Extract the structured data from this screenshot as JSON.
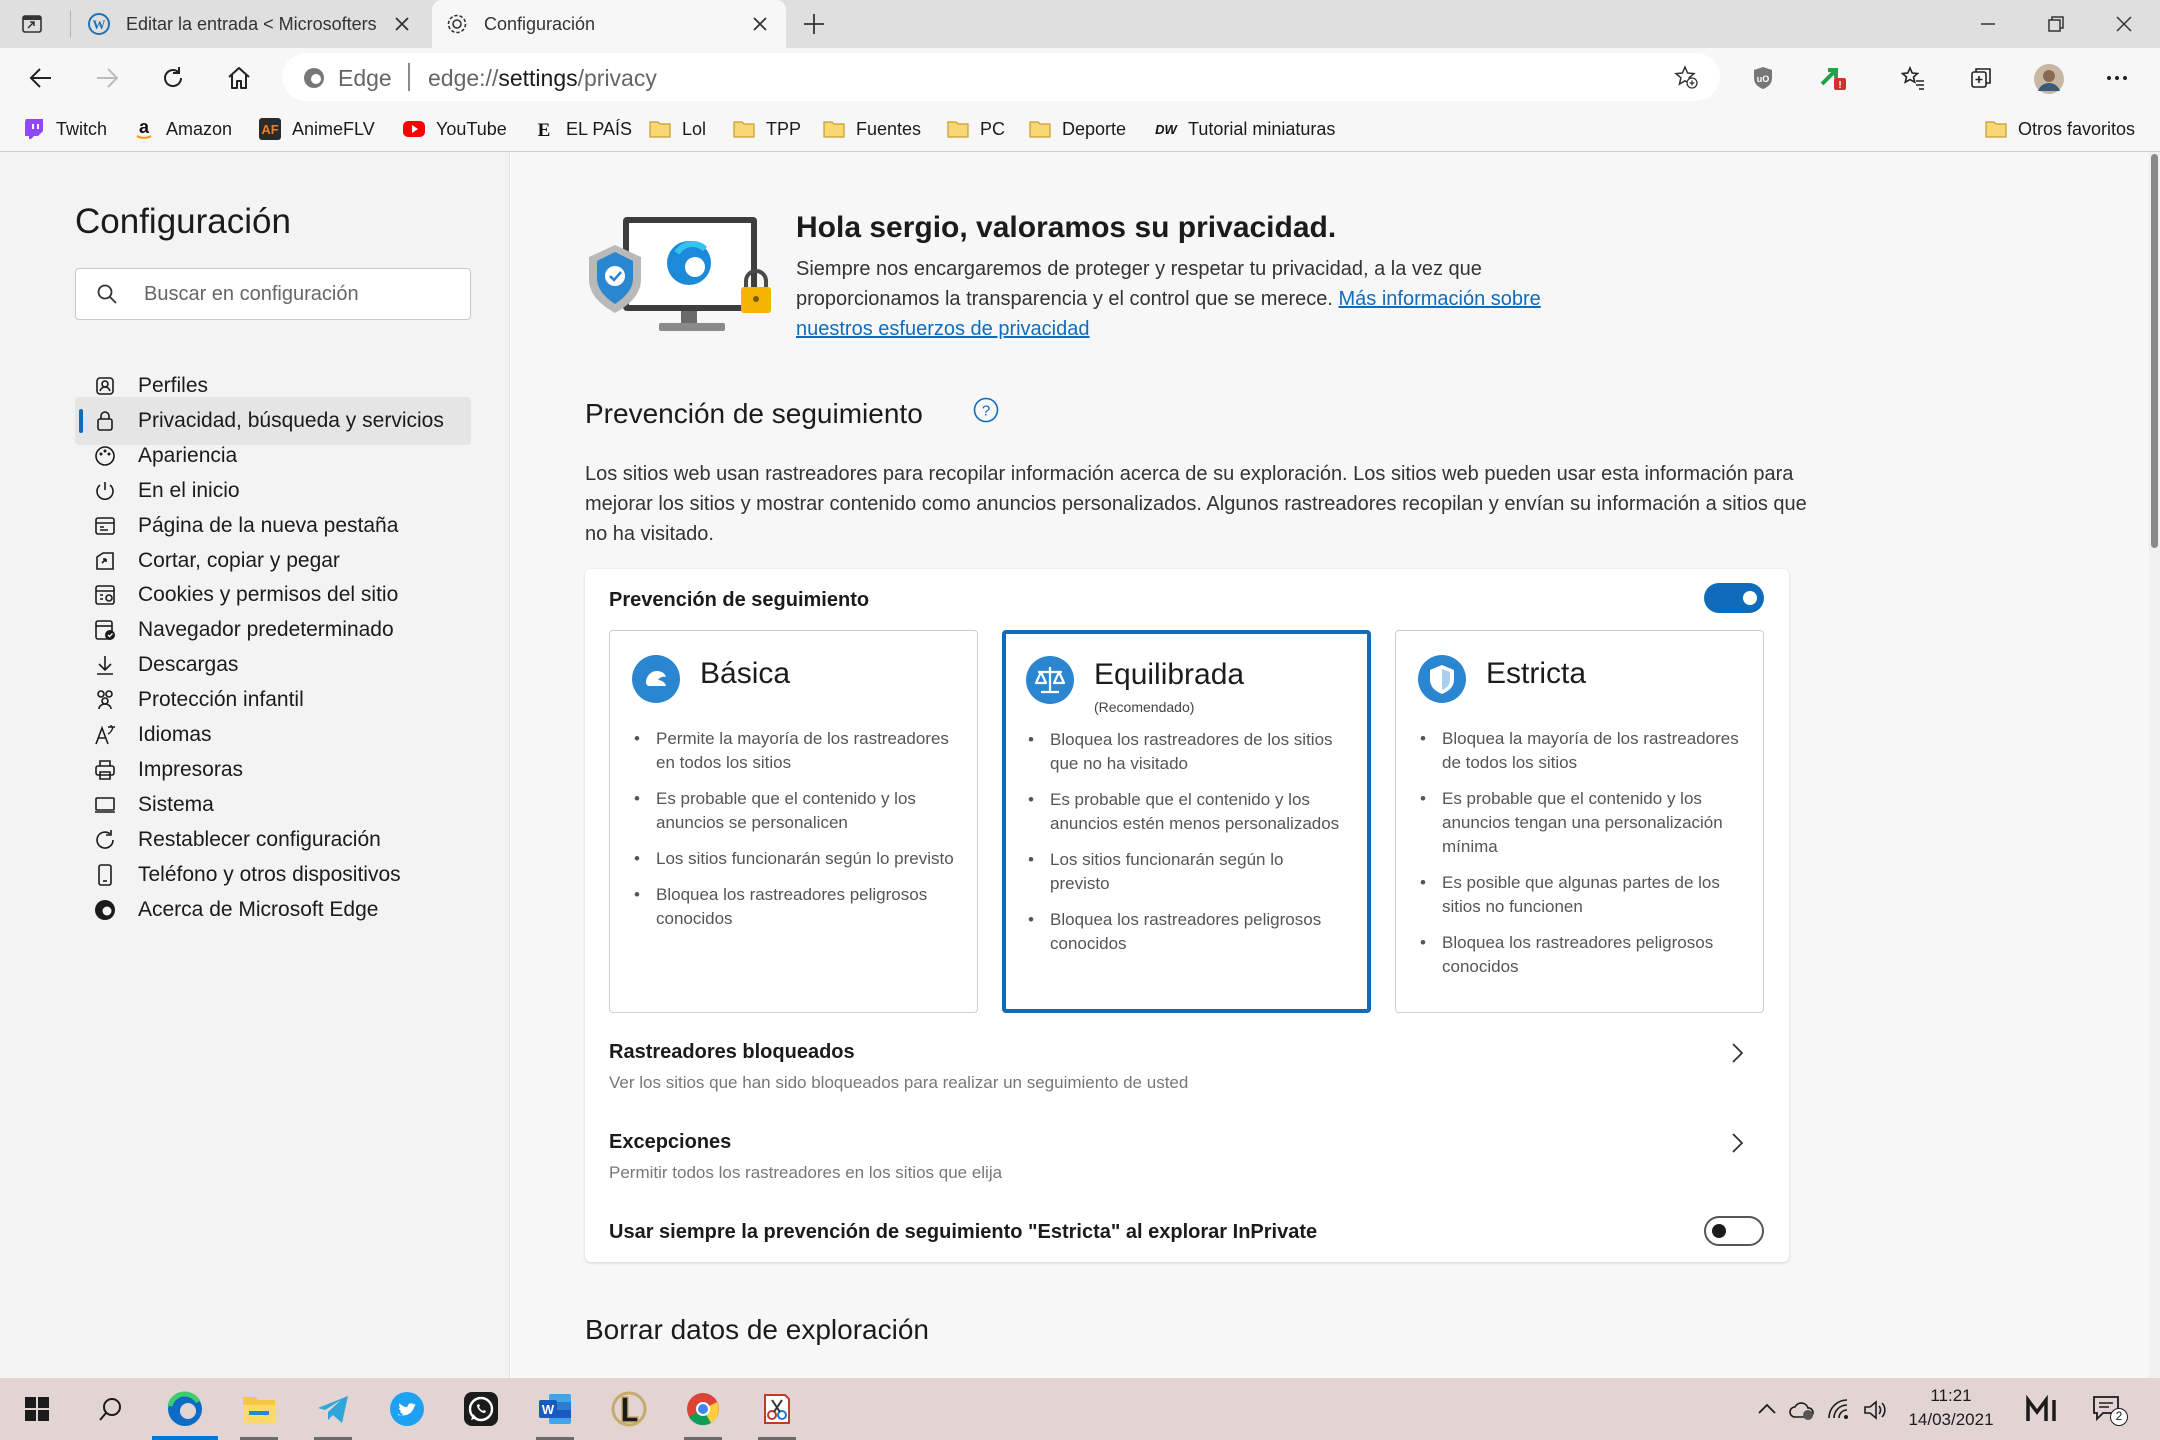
{
  "tabs": [
    {
      "title": "Editar la entrada < Microsofters"
    },
    {
      "title": "Configuración"
    }
  ],
  "address": {
    "brand": "Edge",
    "url_prefix": "edge://",
    "url_host": "settings",
    "url_path": "/privacy"
  },
  "favorites": [
    {
      "label": "Twitch",
      "icon": "twitch-icon"
    },
    {
      "label": "Amazon",
      "icon": "amazon-icon"
    },
    {
      "label": "AnimeFLV",
      "icon": "animeflv-icon"
    },
    {
      "label": "YouTube",
      "icon": "youtube-icon"
    },
    {
      "label": "EL PAÍS",
      "icon": "elpais-icon"
    },
    {
      "label": "Lol",
      "icon": "folder-icon"
    },
    {
      "label": "TPP",
      "icon": "folder-icon"
    },
    {
      "label": "Fuentes",
      "icon": "folder-icon"
    },
    {
      "label": "PC",
      "icon": "folder-icon"
    },
    {
      "label": "Deporte",
      "icon": "folder-icon"
    },
    {
      "label": "Tutorial miniaturas",
      "icon": "dw-icon"
    }
  ],
  "other_favorites": "Otros favoritos",
  "sidebar": {
    "title": "Configuración",
    "search_placeholder": "Buscar en configuración",
    "items": [
      {
        "label": "Perfiles"
      },
      {
        "label": "Privacidad, búsqueda y servicios"
      },
      {
        "label": "Apariencia"
      },
      {
        "label": "En el inicio"
      },
      {
        "label": "Página de la nueva pestaña"
      },
      {
        "label": "Cortar, copiar y pegar"
      },
      {
        "label": "Cookies y permisos del sitio"
      },
      {
        "label": "Navegador predeterminado"
      },
      {
        "label": "Descargas"
      },
      {
        "label": "Protección infantil"
      },
      {
        "label": "Idiomas"
      },
      {
        "label": "Impresoras"
      },
      {
        "label": "Sistema"
      },
      {
        "label": "Restablecer configuración"
      },
      {
        "label": "Teléfono y otros dispositivos"
      },
      {
        "label": "Acerca de Microsoft Edge"
      }
    ],
    "selected": "Privacidad, búsqueda y servicios"
  },
  "hero": {
    "title": "Hola sergio, valoramos su privacidad.",
    "body": "Siempre nos encargaremos de proteger y respetar tu privacidad, a la vez que proporcionamos la transparencia y el control que se merece. ",
    "link": "Más información sobre nuestros esfuerzos de privacidad"
  },
  "tracking": {
    "heading": "Prevención de seguimiento",
    "description": "Los sitios web usan rastreadores para recopilar información acerca de su exploración. Los sitios web pueden usar esta información para mejorar los sitios y mostrar contenido como anuncios personalizados. Algunos rastreadores recopilan y envían su información a sitios que no ha visitado.",
    "toggle_label": "Prevención de seguimiento",
    "enabled": true,
    "levels": [
      {
        "title": "Básica",
        "subtitle": "",
        "bullets": [
          "Permite la mayoría de los rastreadores en todos los sitios",
          "Es probable que el contenido y los anuncios se personalicen",
          "Los sitios funcionarán según lo previsto",
          "Bloquea los rastreadores peligrosos conocidos"
        ]
      },
      {
        "title": "Equilibrada",
        "subtitle": "(Recomendado)",
        "bullets": [
          "Bloquea los rastreadores de los sitios que no ha visitado",
          "Es probable que el contenido y los anuncios estén menos personalizados",
          "Los sitios funcionarán según lo previsto",
          "Bloquea los rastreadores peligrosos conocidos"
        ]
      },
      {
        "title": "Estricta",
        "subtitle": "",
        "bullets": [
          "Bloquea la mayoría de los rastreadores de todos los sitios",
          "Es probable que el contenido y los anuncios tengan una personalización mínima",
          "Es posible que algunas partes de los sitios no funcionen",
          "Bloquea los rastreadores peligrosos conocidos"
        ]
      }
    ],
    "selected_level": "Equilibrada",
    "blocked": {
      "title": "Rastreadores bloqueados",
      "subtitle": "Ver los sitios que han sido bloqueados para realizar un seguimiento de usted"
    },
    "exceptions": {
      "title": "Excepciones",
      "subtitle": "Permitir todos los rastreadores en los sitios que elija"
    },
    "inprivate": {
      "label": "Usar siempre la prevención de seguimiento \"Estricta\" al explorar InPrivate",
      "enabled": false
    }
  },
  "next_section": "Borrar datos de exploración",
  "taskbar": {
    "apps": [
      "edge-icon",
      "file-explorer-icon",
      "telegram-icon",
      "twitter-icon",
      "whatsapp-icon",
      "word-icon",
      "league-icon",
      "chrome-icon",
      "snip-icon"
    ],
    "time": "11:21",
    "date": "14/03/2021",
    "notification_count": "2"
  },
  "colors": {
    "accent": "#0f6cbd",
    "taskbar": "#e3d4d4"
  }
}
